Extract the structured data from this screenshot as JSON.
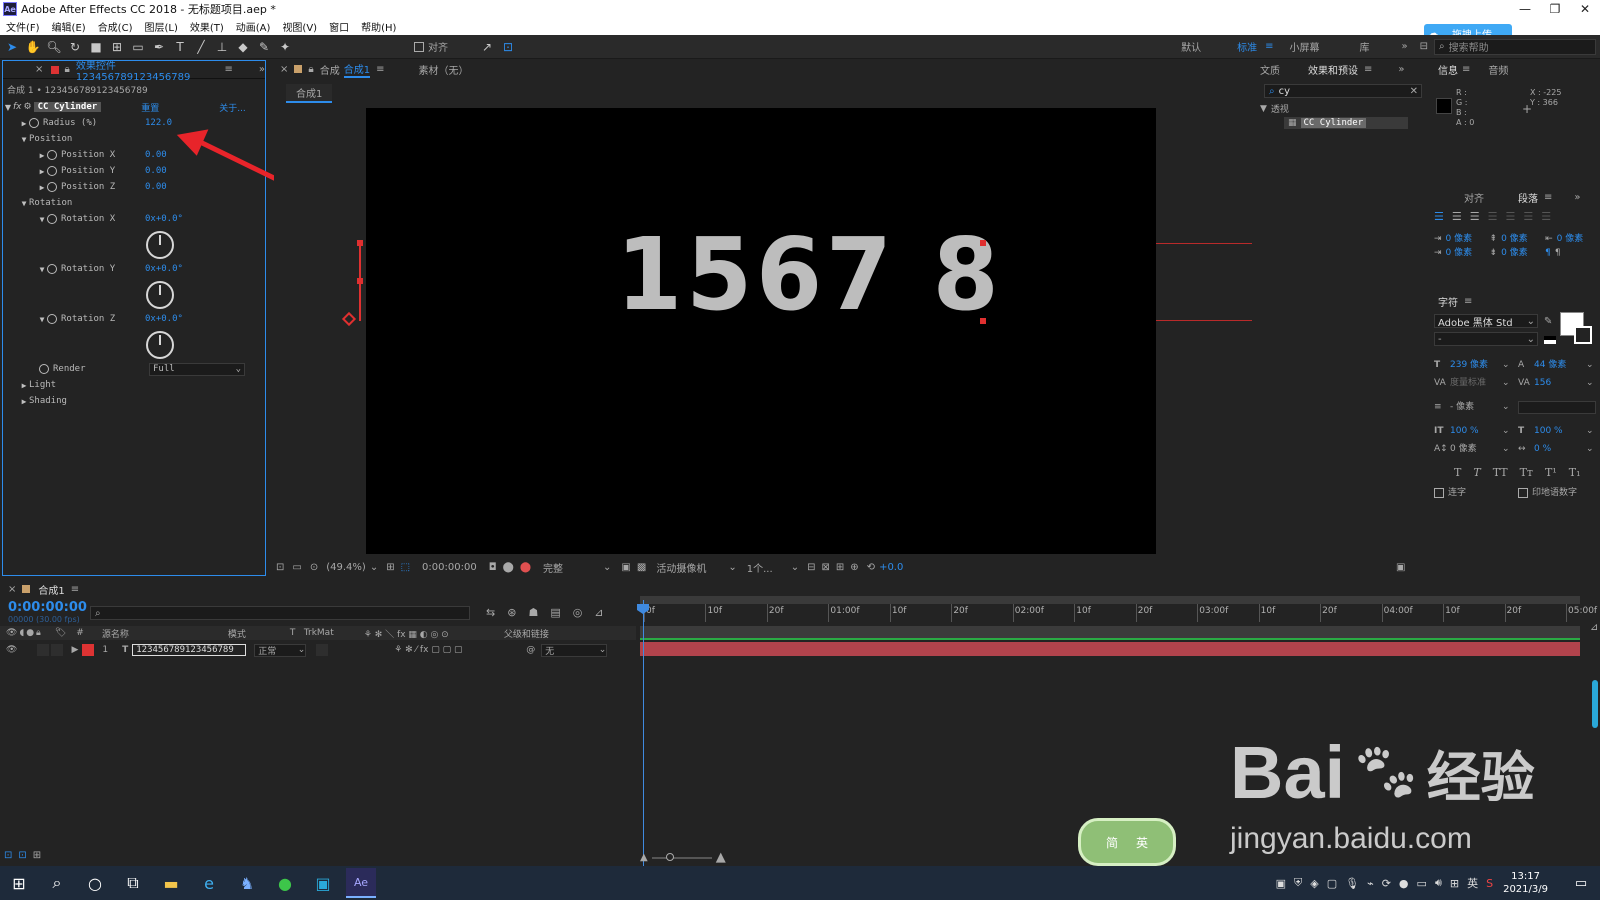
{
  "window": {
    "title": "Adobe After Effects CC 2018 - 无标题项目.aep *",
    "app_badge": "Ae"
  },
  "menu": [
    "文件(F)",
    "编辑(E)",
    "合成(C)",
    "图层(L)",
    "效果(T)",
    "动画(A)",
    "视图(V)",
    "窗口",
    "帮助(H)"
  ],
  "upload": {
    "label": "拖拽上传"
  },
  "toolbar": {
    "align_label": "对齐",
    "workspaces": [
      "默认",
      "标准",
      "小屏幕",
      "库"
    ],
    "search_placeholder": "搜索帮助"
  },
  "effect_panel": {
    "tab": "效果控件 123456789123456789",
    "breadcrumb": "合成 1 • 123456789123456789",
    "effect_name": "CC Cylinder",
    "reset": "重置",
    "about": "关于...",
    "props": {
      "radius_label": "Radius (%)",
      "radius_value": "122.0",
      "position_label": "Position",
      "pos_x_label": "Position X",
      "pos_x_value": "0.00",
      "pos_y_label": "Position Y",
      "pos_y_value": "0.00",
      "pos_z_label": "Position Z",
      "pos_z_value": "0.00",
      "rotation_label": "Rotation",
      "rot_x_label": "Rotation X",
      "rot_x_value": "0x+0.0°",
      "rot_y_label": "Rotation Y",
      "rot_y_value": "0x+0.0°",
      "rot_z_label": "Rotation Z",
      "rot_z_value": "0x+0.0°",
      "render_label": "Render",
      "render_value": "Full",
      "light_label": "Light",
      "shading_label": "Shading"
    }
  },
  "comp_panel": {
    "tab_prefix": "合成",
    "tab_name": "合成1",
    "footage_tab": "素材（无）",
    "sub_tab": "合成1",
    "canvas_text": "1567 8",
    "bottom": {
      "zoom": "(49.4%)",
      "time": "0:00:00:00",
      "quality": "完整",
      "camera": "活动摄像机",
      "views": "1个...",
      "exposure": "+0.0"
    }
  },
  "effects_presets": {
    "tabs": [
      "文质",
      "效果和预设"
    ],
    "search_value": "cy",
    "category": "透视",
    "item": "CC Cylinder"
  },
  "info_panel": {
    "tabs": [
      "信息",
      "音频"
    ],
    "rgba": [
      "R :",
      "G :",
      "B :",
      "A : 0"
    ],
    "x": "X : -225",
    "y": "Y : 366"
  },
  "paragraph_panel": {
    "tabs": [
      "对齐",
      "段落"
    ],
    "indent_values": [
      "0 像素",
      "0 像素",
      "0 像素",
      "0 像素",
      "0 像素"
    ]
  },
  "character_panel": {
    "title": "字符",
    "font": "Adobe 黑体 Std",
    "style": "-",
    "size": "239 像素",
    "leading": "44 像素",
    "kerning": "度量标准",
    "tracking": "156",
    "stroke": "- 像素",
    "vscale": "100 %",
    "hscale": "100 %",
    "baseline": "0 像素",
    "tsume": "0 %",
    "ligature": "连字",
    "hindi": "印地语数字"
  },
  "timeline": {
    "tab": "合成1",
    "timecode": "0:00:00:00",
    "fps": "00000 (30.00 fps)",
    "headers": {
      "num": "#",
      "source": "源名称",
      "mode": "模式",
      "t": "T",
      "trkmat": "TrkMat",
      "parent": "父级和链接"
    },
    "layer": {
      "num": "1",
      "type": "T",
      "name": "123456789123456789",
      "mode": "正常",
      "parent": "无"
    },
    "ruler": [
      "0f",
      "10f",
      "20f",
      "01:00f",
      "10f",
      "20f",
      "02:00f",
      "10f",
      "20f",
      "03:00f",
      "10f",
      "20f",
      "04:00f",
      "10f",
      "20f",
      "05:00f"
    ]
  },
  "watermark": {
    "brand": "Bai",
    "brand2": "经验",
    "url": "jingyan.baidu.com",
    "badge": "简",
    "badge2": "英"
  },
  "taskbar": {
    "time": "13:17",
    "date": "2021/3/9",
    "ime": "英"
  }
}
